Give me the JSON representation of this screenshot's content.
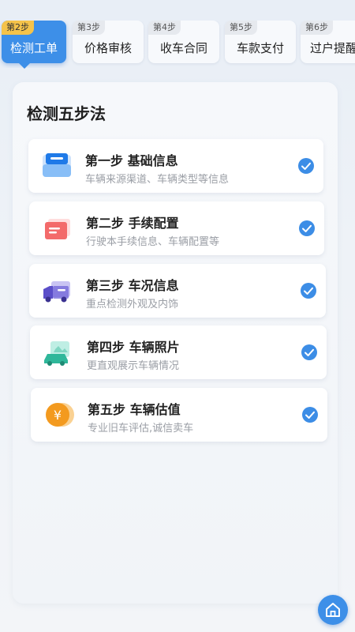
{
  "tabs": [
    {
      "step": "第2步",
      "label": "检测工单",
      "active": true
    },
    {
      "step": "第3步",
      "label": "价格审核",
      "active": false
    },
    {
      "step": "第4步",
      "label": "收车合同",
      "active": false
    },
    {
      "step": "第5步",
      "label": "车款支付",
      "active": false
    },
    {
      "step": "第6步",
      "label": "过户提醒",
      "active": false
    }
  ],
  "panel": {
    "title": "检测五步法",
    "steps": [
      {
        "title": "第一步 基础信息",
        "desc": "车辆来源渠道、车辆类型等信息",
        "icon": "folder-icon",
        "done": true
      },
      {
        "title": "第二步 手续配置",
        "desc": "行驶本手续信息、车辆配置等",
        "icon": "id-card-icon",
        "done": true
      },
      {
        "title": "第三步 车况信息",
        "desc": "重点检测外观及内饰",
        "icon": "truck-icon",
        "done": true
      },
      {
        "title": "第四步 车辆照片",
        "desc": "更直观展示车辆情况",
        "icon": "car-photo-icon",
        "done": true
      },
      {
        "title": "第五步 车辆估值",
        "desc": "专业旧车评估,诚信卖车",
        "icon": "yuan-coin-icon",
        "done": true
      }
    ]
  },
  "colors": {
    "accent": "#3d8fe8",
    "active_step_badge": "#f5c34a",
    "check": "#3c8de6"
  }
}
